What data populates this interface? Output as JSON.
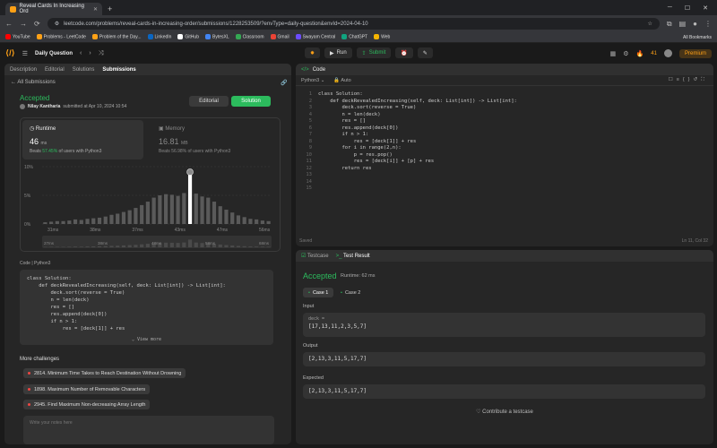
{
  "browser": {
    "tab_title": "Reveal Cards In Increasing Ord",
    "url": "leetcode.com/problems/reveal-cards-in-increasing-order/submissions/1228253509/?envType=daily-question&envId=2024-04-10",
    "bookmarks": [
      "YouTube",
      "Problems - LeetCode",
      "Problem of the Day...",
      "LinkedIn",
      "GitHub",
      "BytesXL",
      "Classroom",
      "Gmail",
      "Swayam Central",
      "ChatGPT",
      "Web"
    ],
    "all_bookmarks": "All Bookmarks"
  },
  "topbar": {
    "title": "Daily Question",
    "run": "Run",
    "submit": "Submit",
    "streak": "41",
    "premium": "Premium"
  },
  "left": {
    "tabs": [
      "Description",
      "Editorial",
      "Solutions",
      "Submissions"
    ],
    "all_submissions": "All Submissions",
    "status": "Accepted",
    "author": "Nilay Kantharia",
    "submitted": "submitted at Apr 10, 2024 10:54",
    "editorial_btn": "Editorial",
    "solution_btn": "Solution",
    "runtime_label": "Runtime",
    "runtime_value": "46",
    "runtime_unit": "ms",
    "runtime_beats_pre": "Beats",
    "runtime_beats_pct": "57.45%",
    "runtime_beats_post": "of users with Python3",
    "memory_label": "Memory",
    "memory_value": "16.81",
    "memory_unit": "MB",
    "memory_beats": "Beats 56.98% of users with Python3",
    "code_header": "Code  |  Python3",
    "view_more": "View more",
    "more_challenges": "More challenges",
    "challenges": [
      "2814. Minimum Time Takes to Reach Destination Without Drowning",
      "1898. Maximum Number of Removable Characters",
      "2945. Find Maximum Non-decreasing Array Length"
    ],
    "notes_placeholder": "Write your notes here"
  },
  "chart_data": {
    "type": "bar",
    "ytick_labels": [
      "10%",
      "5%",
      "0%"
    ],
    "xtick_labels": [
      "31ms",
      "38ms",
      "37ms",
      "43ms",
      "47ms",
      "56ms"
    ],
    "mini_labels": [
      "27ms",
      "38ms",
      "48ms",
      "58ms",
      "68ms"
    ],
    "values": [
      0.3,
      0.4,
      0.5,
      0.5,
      0.6,
      0.8,
      0.7,
      0.9,
      1.0,
      1.1,
      1.3,
      1.6,
      1.8,
      2.1,
      2.4,
      2.8,
      3.3,
      3.9,
      4.6,
      5.0,
      5.2,
      5.1,
      4.9,
      5.4,
      8.6,
      5.3,
      4.8,
      4.6,
      3.9,
      3.1,
      2.5,
      2.0,
      1.5,
      1.2,
      0.9,
      0.8,
      0.6,
      0.5
    ],
    "highlight_index": 24,
    "ylim": [
      0,
      10
    ]
  },
  "code_preview": [
    "class Solution:",
    "    def deckRevealedIncreasing(self, deck: List[int]) -> List[int]:",
    "        deck.sort(reverse = True)",
    "        n = len(deck)",
    "        res = []",
    "        res.append(deck[0])",
    "        if n > 1:",
    "            res = [deck[1]] + res"
  ],
  "code": {
    "header": "Code",
    "language": "Python3",
    "auto": "Auto",
    "lines": [
      "class Solution:",
      "    def deckRevealedIncreasing(self, deck: List[int]) -> List[int]:",
      "        deck.sort(reverse = True)",
      "        n = len(deck)",
      "        res = []",
      "        res.append(deck[0])",
      "        if n > 1:",
      "            res = [deck[1]] + res",
      "        for i in range(2,n):",
      "            p = res.pop()",
      "            res = [deck[i]] + [p] + res",
      "        return res",
      "",
      "",
      ""
    ],
    "saved": "Saved",
    "cursor": "Ln 11, Col 32"
  },
  "testpanel": {
    "tab_testcase": "Testcase",
    "tab_result": "Test Result",
    "status": "Accepted",
    "runtime": "Runtime: 62 ms",
    "case1": "Case 1",
    "case2": "Case 2",
    "input_label": "Input",
    "input_var": "deck =",
    "input_value": "[17,13,11,2,3,5,7]",
    "output_label": "Output",
    "output_value": "[2,13,3,11,5,17,7]",
    "expected_label": "Expected",
    "expected_value": "[2,13,3,11,5,17,7]",
    "contribute": "Contribute a testcase"
  },
  "colors": {
    "accent": "#2cbb5d",
    "brand": "#ffa116",
    "bg": "#1a1a1a",
    "panel": "#262626"
  }
}
